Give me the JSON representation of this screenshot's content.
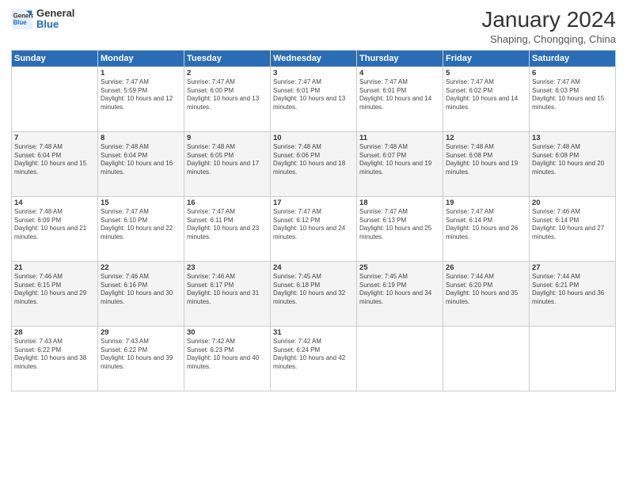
{
  "logo": {
    "line1": "General",
    "line2": "Blue"
  },
  "title": "January 2024",
  "subtitle": "Shaping, Chongqing, China",
  "weekdays": [
    "Sunday",
    "Monday",
    "Tuesday",
    "Wednesday",
    "Thursday",
    "Friday",
    "Saturday"
  ],
  "weeks": [
    [
      {
        "num": "",
        "sunrise": "",
        "sunset": "",
        "daylight": ""
      },
      {
        "num": "1",
        "sunrise": "Sunrise: 7:47 AM",
        "sunset": "Sunset: 5:59 PM",
        "daylight": "Daylight: 10 hours and 12 minutes."
      },
      {
        "num": "2",
        "sunrise": "Sunrise: 7:47 AM",
        "sunset": "Sunset: 6:00 PM",
        "daylight": "Daylight: 10 hours and 13 minutes."
      },
      {
        "num": "3",
        "sunrise": "Sunrise: 7:47 AM",
        "sunset": "Sunset: 6:01 PM",
        "daylight": "Daylight: 10 hours and 13 minutes."
      },
      {
        "num": "4",
        "sunrise": "Sunrise: 7:47 AM",
        "sunset": "Sunset: 6:01 PM",
        "daylight": "Daylight: 10 hours and 14 minutes."
      },
      {
        "num": "5",
        "sunrise": "Sunrise: 7:47 AM",
        "sunset": "Sunset: 6:02 PM",
        "daylight": "Daylight: 10 hours and 14 minutes."
      },
      {
        "num": "6",
        "sunrise": "Sunrise: 7:47 AM",
        "sunset": "Sunset: 6:03 PM",
        "daylight": "Daylight: 10 hours and 15 minutes."
      }
    ],
    [
      {
        "num": "7",
        "sunrise": "Sunrise: 7:48 AM",
        "sunset": "Sunset: 6:04 PM",
        "daylight": "Daylight: 10 hours and 15 minutes."
      },
      {
        "num": "8",
        "sunrise": "Sunrise: 7:48 AM",
        "sunset": "Sunset: 6:04 PM",
        "daylight": "Daylight: 10 hours and 16 minutes."
      },
      {
        "num": "9",
        "sunrise": "Sunrise: 7:48 AM",
        "sunset": "Sunset: 6:05 PM",
        "daylight": "Daylight: 10 hours and 17 minutes."
      },
      {
        "num": "10",
        "sunrise": "Sunrise: 7:48 AM",
        "sunset": "Sunset: 6:06 PM",
        "daylight": "Daylight: 10 hours and 18 minutes."
      },
      {
        "num": "11",
        "sunrise": "Sunrise: 7:48 AM",
        "sunset": "Sunset: 6:07 PM",
        "daylight": "Daylight: 10 hours and 19 minutes."
      },
      {
        "num": "12",
        "sunrise": "Sunrise: 7:48 AM",
        "sunset": "Sunset: 6:08 PM",
        "daylight": "Daylight: 10 hours and 19 minutes."
      },
      {
        "num": "13",
        "sunrise": "Sunrise: 7:48 AM",
        "sunset": "Sunset: 6:08 PM",
        "daylight": "Daylight: 10 hours and 20 minutes."
      }
    ],
    [
      {
        "num": "14",
        "sunrise": "Sunrise: 7:48 AM",
        "sunset": "Sunset: 6:09 PM",
        "daylight": "Daylight: 10 hours and 21 minutes."
      },
      {
        "num": "15",
        "sunrise": "Sunrise: 7:47 AM",
        "sunset": "Sunset: 6:10 PM",
        "daylight": "Daylight: 10 hours and 22 minutes."
      },
      {
        "num": "16",
        "sunrise": "Sunrise: 7:47 AM",
        "sunset": "Sunset: 6:11 PM",
        "daylight": "Daylight: 10 hours and 23 minutes."
      },
      {
        "num": "17",
        "sunrise": "Sunrise: 7:47 AM",
        "sunset": "Sunset: 6:12 PM",
        "daylight": "Daylight: 10 hours and 24 minutes."
      },
      {
        "num": "18",
        "sunrise": "Sunrise: 7:47 AM",
        "sunset": "Sunset: 6:13 PM",
        "daylight": "Daylight: 10 hours and 25 minutes."
      },
      {
        "num": "19",
        "sunrise": "Sunrise: 7:47 AM",
        "sunset": "Sunset: 6:14 PM",
        "daylight": "Daylight: 10 hours and 26 minutes."
      },
      {
        "num": "20",
        "sunrise": "Sunrise: 7:46 AM",
        "sunset": "Sunset: 6:14 PM",
        "daylight": "Daylight: 10 hours and 27 minutes."
      }
    ],
    [
      {
        "num": "21",
        "sunrise": "Sunrise: 7:46 AM",
        "sunset": "Sunset: 6:15 PM",
        "daylight": "Daylight: 10 hours and 29 minutes."
      },
      {
        "num": "22",
        "sunrise": "Sunrise: 7:46 AM",
        "sunset": "Sunset: 6:16 PM",
        "daylight": "Daylight: 10 hours and 30 minutes."
      },
      {
        "num": "23",
        "sunrise": "Sunrise: 7:46 AM",
        "sunset": "Sunset: 6:17 PM",
        "daylight": "Daylight: 10 hours and 31 minutes."
      },
      {
        "num": "24",
        "sunrise": "Sunrise: 7:45 AM",
        "sunset": "Sunset: 6:18 PM",
        "daylight": "Daylight: 10 hours and 32 minutes."
      },
      {
        "num": "25",
        "sunrise": "Sunrise: 7:45 AM",
        "sunset": "Sunset: 6:19 PM",
        "daylight": "Daylight: 10 hours and 34 minutes."
      },
      {
        "num": "26",
        "sunrise": "Sunrise: 7:44 AM",
        "sunset": "Sunset: 6:20 PM",
        "daylight": "Daylight: 10 hours and 35 minutes."
      },
      {
        "num": "27",
        "sunrise": "Sunrise: 7:44 AM",
        "sunset": "Sunset: 6:21 PM",
        "daylight": "Daylight: 10 hours and 36 minutes."
      }
    ],
    [
      {
        "num": "28",
        "sunrise": "Sunrise: 7:43 AM",
        "sunset": "Sunset: 6:22 PM",
        "daylight": "Daylight: 10 hours and 38 minutes."
      },
      {
        "num": "29",
        "sunrise": "Sunrise: 7:43 AM",
        "sunset": "Sunset: 6:22 PM",
        "daylight": "Daylight: 10 hours and 39 minutes."
      },
      {
        "num": "30",
        "sunrise": "Sunrise: 7:42 AM",
        "sunset": "Sunset: 6:23 PM",
        "daylight": "Daylight: 10 hours and 40 minutes."
      },
      {
        "num": "31",
        "sunrise": "Sunrise: 7:42 AM",
        "sunset": "Sunset: 6:24 PM",
        "daylight": "Daylight: 10 hours and 42 minutes."
      },
      {
        "num": "",
        "sunrise": "",
        "sunset": "",
        "daylight": ""
      },
      {
        "num": "",
        "sunrise": "",
        "sunset": "",
        "daylight": ""
      },
      {
        "num": "",
        "sunrise": "",
        "sunset": "",
        "daylight": ""
      }
    ]
  ]
}
